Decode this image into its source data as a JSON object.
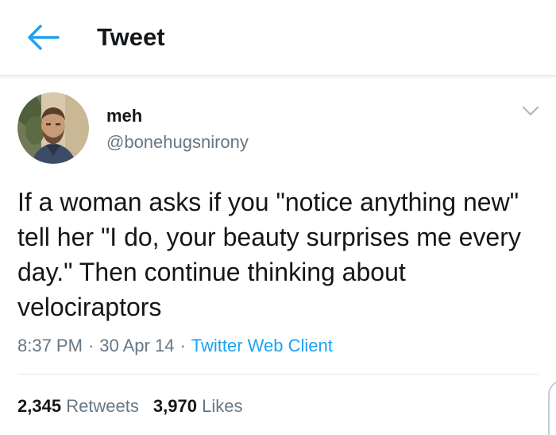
{
  "header": {
    "title": "Tweet",
    "back_icon": "arrow-left-icon",
    "accent": "#1da1f2"
  },
  "tweet": {
    "author_name": "meh",
    "author_handle": "@bonehugsnirony",
    "text": "If a woman asks if you \"notice anything new\" tell her \"I do, your beauty surprises me every day.\" Then continue thinking about velociraptors",
    "time": "8:37 PM",
    "date": "30 Apr 14",
    "source": "Twitter Web Client",
    "separator": "·",
    "retweets_count": "2,345",
    "retweets_label": "Retweets",
    "likes_count": "3,970",
    "likes_label": "Likes",
    "menu_icon": "chevron-down-icon"
  },
  "colors": {
    "text": "#14171a",
    "secondary": "#657786",
    "link": "#1da1f2",
    "divider": "#e1e8ed"
  }
}
